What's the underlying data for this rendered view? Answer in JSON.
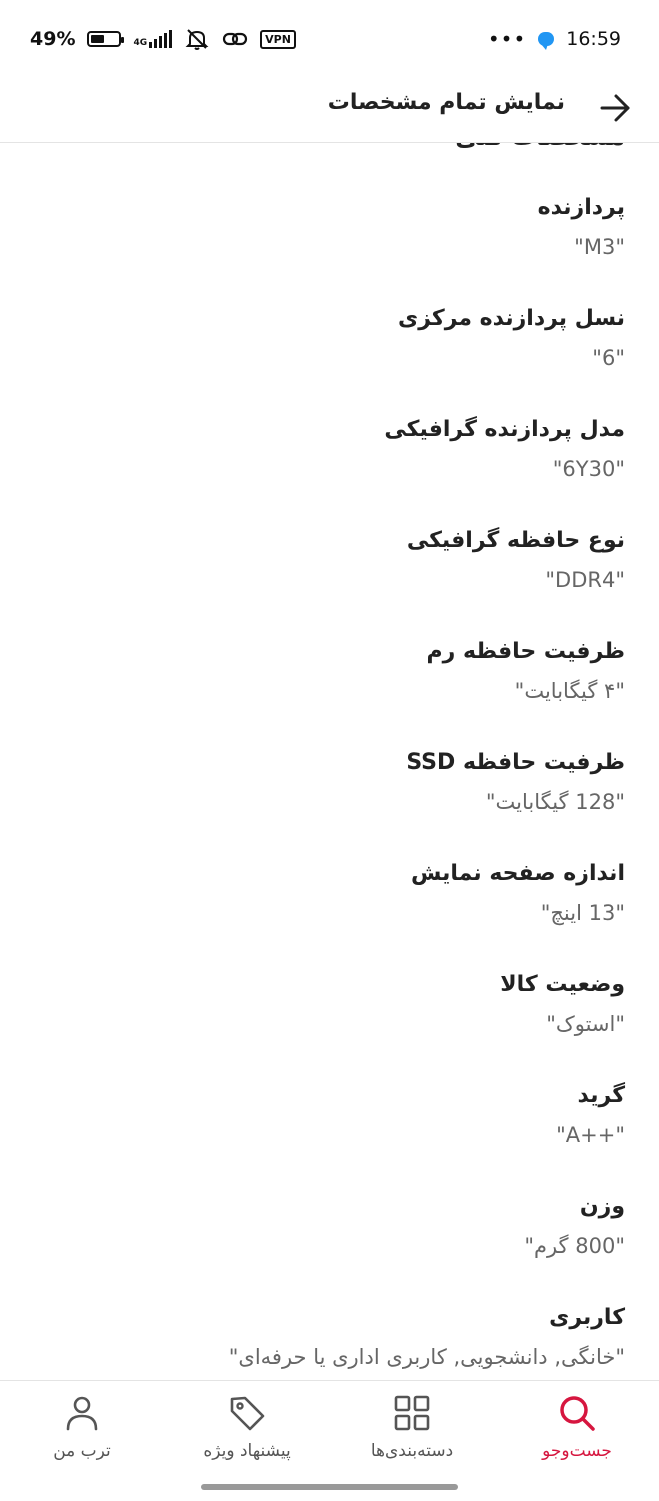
{
  "status_bar": {
    "battery_text": "49%",
    "battery_level": 0.49,
    "network_label": "4G",
    "vpn_label": "VPN",
    "more_dots": "•••",
    "time": "16:59"
  },
  "header": {
    "title": "نمایش تمام مشخصات",
    "back_icon": "arrow-right-icon"
  },
  "section": {
    "title": "مشخصات کلی"
  },
  "specs": [
    {
      "label": "پردازنده",
      "value": "\"M3\""
    },
    {
      "label": "نسل پردازنده مرکزی",
      "value": "\"6\""
    },
    {
      "label": "مدل پردازنده گرافیکی",
      "value": "\"6Y30\""
    },
    {
      "label": "نوع حافظه گرافیکی",
      "value": "\"DDR4\""
    },
    {
      "label": "ظرفیت حافظه رم",
      "value": "\"۴ گیگابایت\""
    },
    {
      "label": "ظرفیت حافظه SSD",
      "value": "\"128 گیگابایت\""
    },
    {
      "label": "اندازه صفحه نمایش",
      "value": "\"13 اینچ\""
    },
    {
      "label": "وضعیت کالا",
      "value": "\"استوک\""
    },
    {
      "label": "گرید",
      "value": "\"++A\""
    },
    {
      "label": "وزن",
      "value": "\"800 گرم\""
    },
    {
      "label": "کاربری",
      "value": "\"خانگی, دانشجویی, کاربری اداری یا حرفه‌ای\""
    }
  ],
  "bottom_nav": {
    "items": [
      {
        "label": "جست‌وجو",
        "icon": "search-icon",
        "active": true,
        "color": "#d6163f"
      },
      {
        "label": "دسته‌بندی‌ها",
        "icon": "grid-icon",
        "active": false
      },
      {
        "label": "پیشنهاد ویژه",
        "icon": "tag-icon",
        "active": false
      },
      {
        "label": "ترب من",
        "icon": "user-icon",
        "active": false
      }
    ]
  }
}
